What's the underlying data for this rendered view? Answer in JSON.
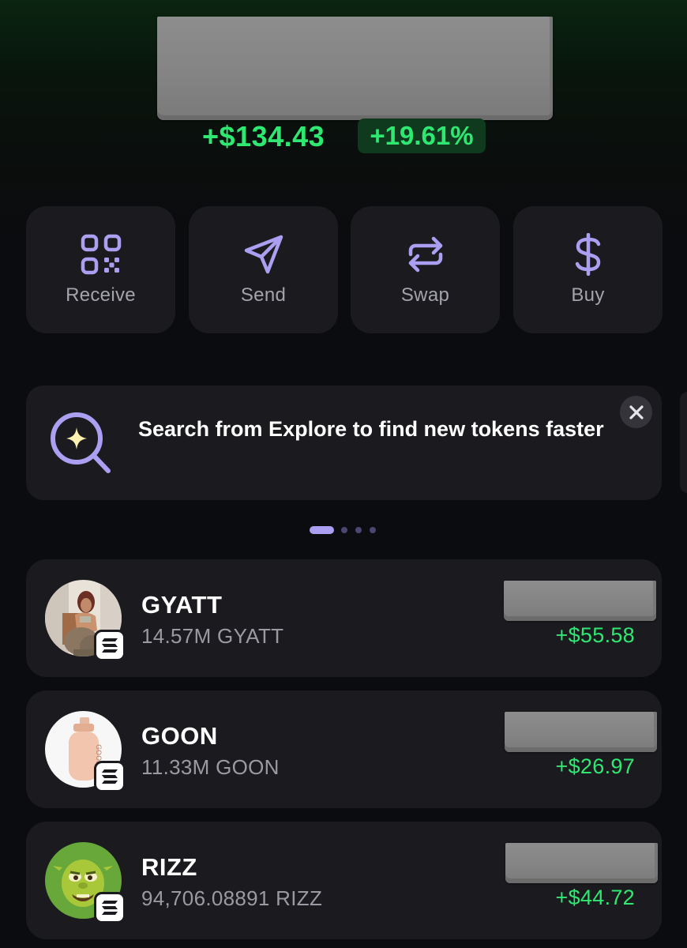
{
  "portfolio": {
    "pnl_amount": "+$134.43",
    "pnl_percent": "+19.61%"
  },
  "actions": [
    {
      "label": "Receive",
      "icon": "qr-code-icon"
    },
    {
      "label": "Send",
      "icon": "paper-plane-icon"
    },
    {
      "label": "Swap",
      "icon": "swap-arrows-icon"
    },
    {
      "label": "Buy",
      "icon": "dollar-icon"
    }
  ],
  "promo": {
    "text": "Search from Explore to find new tokens faster",
    "icon": "search-sparkle-icon",
    "close_icon": "close-icon",
    "pages": 4,
    "active_page": 1
  },
  "tokens": [
    {
      "name": "GYATT",
      "amount": "14.57M GYATT",
      "change": "+$55.58",
      "chain_icon": "solana-icon"
    },
    {
      "name": "GOON",
      "amount": "11.33M GOON",
      "change": "+$26.97",
      "chain_icon": "solana-icon"
    },
    {
      "name": "RIZZ",
      "amount": "94,706.08891 RIZZ",
      "change": "+$44.72",
      "chain_icon": "solana-icon"
    }
  ],
  "colors": {
    "accent_purple": "#ab9ff2",
    "positive_green": "#2ee872",
    "card_bg": "#1b1b1f"
  }
}
